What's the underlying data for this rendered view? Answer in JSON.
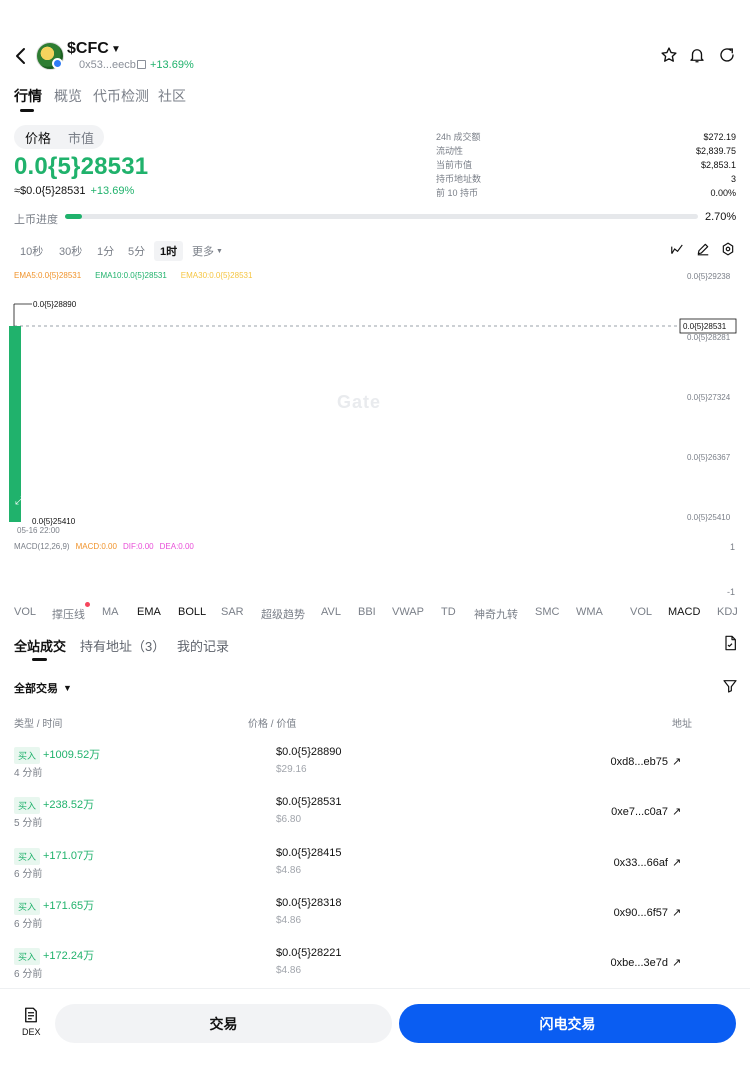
{
  "header": {
    "token_name": "$CFC",
    "address": "0x53...eecb",
    "change": "+13.69%",
    "icons": [
      "back-icon",
      "star-icon",
      "bell-icon",
      "share-icon",
      "copy-icon",
      "caret-down-icon"
    ]
  },
  "tabs": [
    {
      "label": "行情",
      "active": true
    },
    {
      "label": "概览"
    },
    {
      "label": "代币检测"
    },
    {
      "label": "社区"
    }
  ],
  "price_section": {
    "segment": [
      "价格",
      "市值"
    ],
    "price": "0.0{5}28531",
    "sub_price": "≈$0.0{5}28531",
    "sub_change": "+13.69%",
    "stats": [
      {
        "label": "24h 成交额",
        "value": "$272.19"
      },
      {
        "label": "流动性",
        "value": "$2,839.75"
      },
      {
        "label": "当前市值",
        "value": "$2,853.1"
      },
      {
        "label": "持币地址数",
        "value": "3"
      },
      {
        "label": "前 10 持币",
        "value": "0.00%"
      }
    ],
    "progress_label": "上币进度",
    "progress_percent": 2.7,
    "progress_text": "2.70%"
  },
  "intervals": [
    "10秒",
    "30秒",
    "1分",
    "5分",
    "1时",
    "更多"
  ],
  "active_interval": "1时",
  "chart": {
    "ema": [
      {
        "label": "EMA5:0.0{5}28531",
        "color": "#f0932b"
      },
      {
        "label": "EMA10:0.0{5}28531",
        "color": "#20b26c"
      },
      {
        "label": "EMA30:0.0{5}28531",
        "color": "#f5c542"
      }
    ],
    "y_ticks": [
      "0.0{5}29238",
      "0.0{5}28281",
      "0.0{5}27324",
      "0.0{5}26367",
      "0.0{5}25410"
    ],
    "current_price_label": "0.0{5}28531",
    "high_label": "0.0{5}28890",
    "low_label": "0.0{5}25410",
    "x_label": "05-16 22:00",
    "watermark": "Gate",
    "macd": [
      {
        "label": "MACD(12,26,9)",
        "color": "#7a7f88"
      },
      {
        "label": "MACD:0.00",
        "color": "#f0932b"
      },
      {
        "label": "DIF:0.00",
        "color": "#e84fd8"
      },
      {
        "label": "DEA:0.00",
        "color": "#e84fd8"
      }
    ],
    "macd_axis_top": "1",
    "macd_axis_bottom": "-1"
  },
  "chart_data": {
    "type": "candlestick",
    "candles": [
      {
        "time": "05-16 22:00",
        "open": 2.541e-06,
        "high": 2.889e-06,
        "low": 2.541e-06,
        "close": 2.8531e-06
      }
    ],
    "ylim": [
      2.541e-06,
      2.9238e-06
    ]
  },
  "indicators": [
    "VOL",
    "撑压线",
    "MA",
    "EMA",
    "BOLL",
    "SAR",
    "超级趋势",
    "AVL",
    "BBI",
    "VWAP",
    "TD",
    "神奇九转",
    "SMC",
    "WMA",
    "VOL",
    "MACD",
    "KDJ"
  ],
  "trades": {
    "tabs": [
      "全站成交",
      "持有地址（3）",
      "我的记录"
    ],
    "filter": "全部交易",
    "columns": [
      "类型 / 时间",
      "价格 / 价值",
      "地址"
    ],
    "rows": [
      {
        "type": "买入",
        "amount": "+1009.52万",
        "time": "4 分前",
        "price": "$0.0{5}28890",
        "value": "$29.16",
        "address": "0xd8...eb75"
      },
      {
        "type": "买入",
        "amount": "+238.52万",
        "time": "5 分前",
        "price": "$0.0{5}28531",
        "value": "$6.80",
        "address": "0xe7...c0a7"
      },
      {
        "type": "买入",
        "amount": "+171.07万",
        "time": "6 分前",
        "price": "$0.0{5}28415",
        "value": "$4.86",
        "address": "0x33...66af"
      },
      {
        "type": "买入",
        "amount": "+171.65万",
        "time": "6 分前",
        "price": "$0.0{5}28318",
        "value": "$4.86",
        "address": "0x90...6f57"
      },
      {
        "type": "买入",
        "amount": "+172.24万",
        "time": "6 分前",
        "price": "$0.0{5}28221",
        "value": "$4.86",
        "address": "0xbe...3e7d"
      }
    ]
  },
  "bottom": {
    "dex": "DEX",
    "trade": "交易",
    "flash_trade": "闪电交易"
  },
  "colors": {
    "up": "#20b26c",
    "primary": "#0a5df2"
  }
}
